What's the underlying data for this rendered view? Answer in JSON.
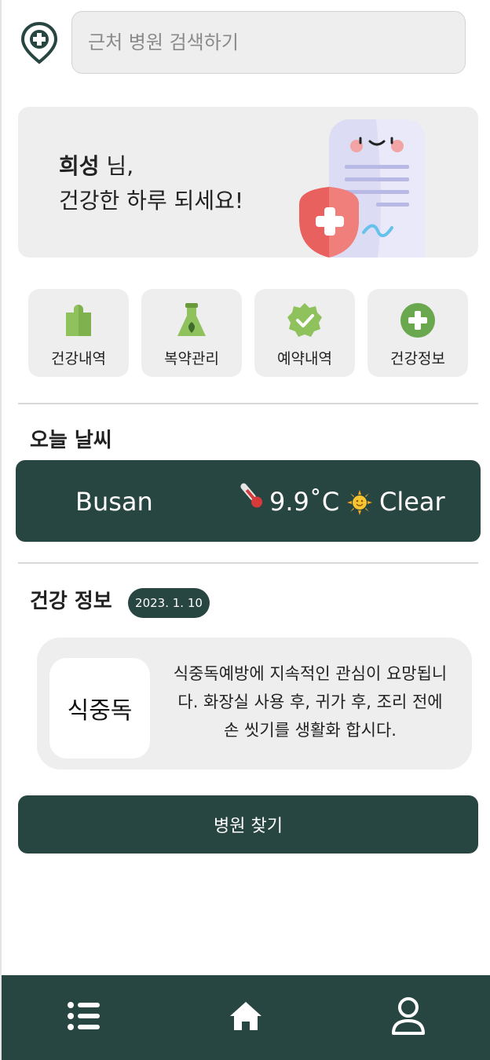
{
  "search": {
    "placeholder": "근처 병원 검색하기"
  },
  "greeting": {
    "name": "희성",
    "suffix": " 님,",
    "message": "건강한 하루 되세요!"
  },
  "quick_menu": [
    {
      "label": "건강내역",
      "icon": "puzzle-icon"
    },
    {
      "label": "복약관리",
      "icon": "flask-icon"
    },
    {
      "label": "예약내역",
      "icon": "check-badge-icon"
    },
    {
      "label": "건강정보",
      "icon": "plus-circle-icon"
    }
  ],
  "weather": {
    "title": "오늘 날씨",
    "city": "Busan",
    "temperature": "9.9˚C",
    "condition": "Clear",
    "temp_icon": "thermometer-icon",
    "condition_icon": "sun-icon"
  },
  "health_info": {
    "title": "건강 정보",
    "date": "2023. 1. 10",
    "topic": "식중독",
    "text": "식중독예방에 지속적인 관심이 요망됩니다. 화장실 사용 후, 귀가 후, 조리 전에 손 씻기를 생활화 합시다."
  },
  "find_button": {
    "label": "병원 찾기"
  },
  "bottom_nav": [
    {
      "icon": "list-icon"
    },
    {
      "icon": "home-icon"
    },
    {
      "icon": "user-icon"
    }
  ],
  "colors": {
    "primary": "#284641",
    "card": "#eeeeee",
    "accent_green": "#6aa84f",
    "accent_red": "#e05a5a"
  }
}
